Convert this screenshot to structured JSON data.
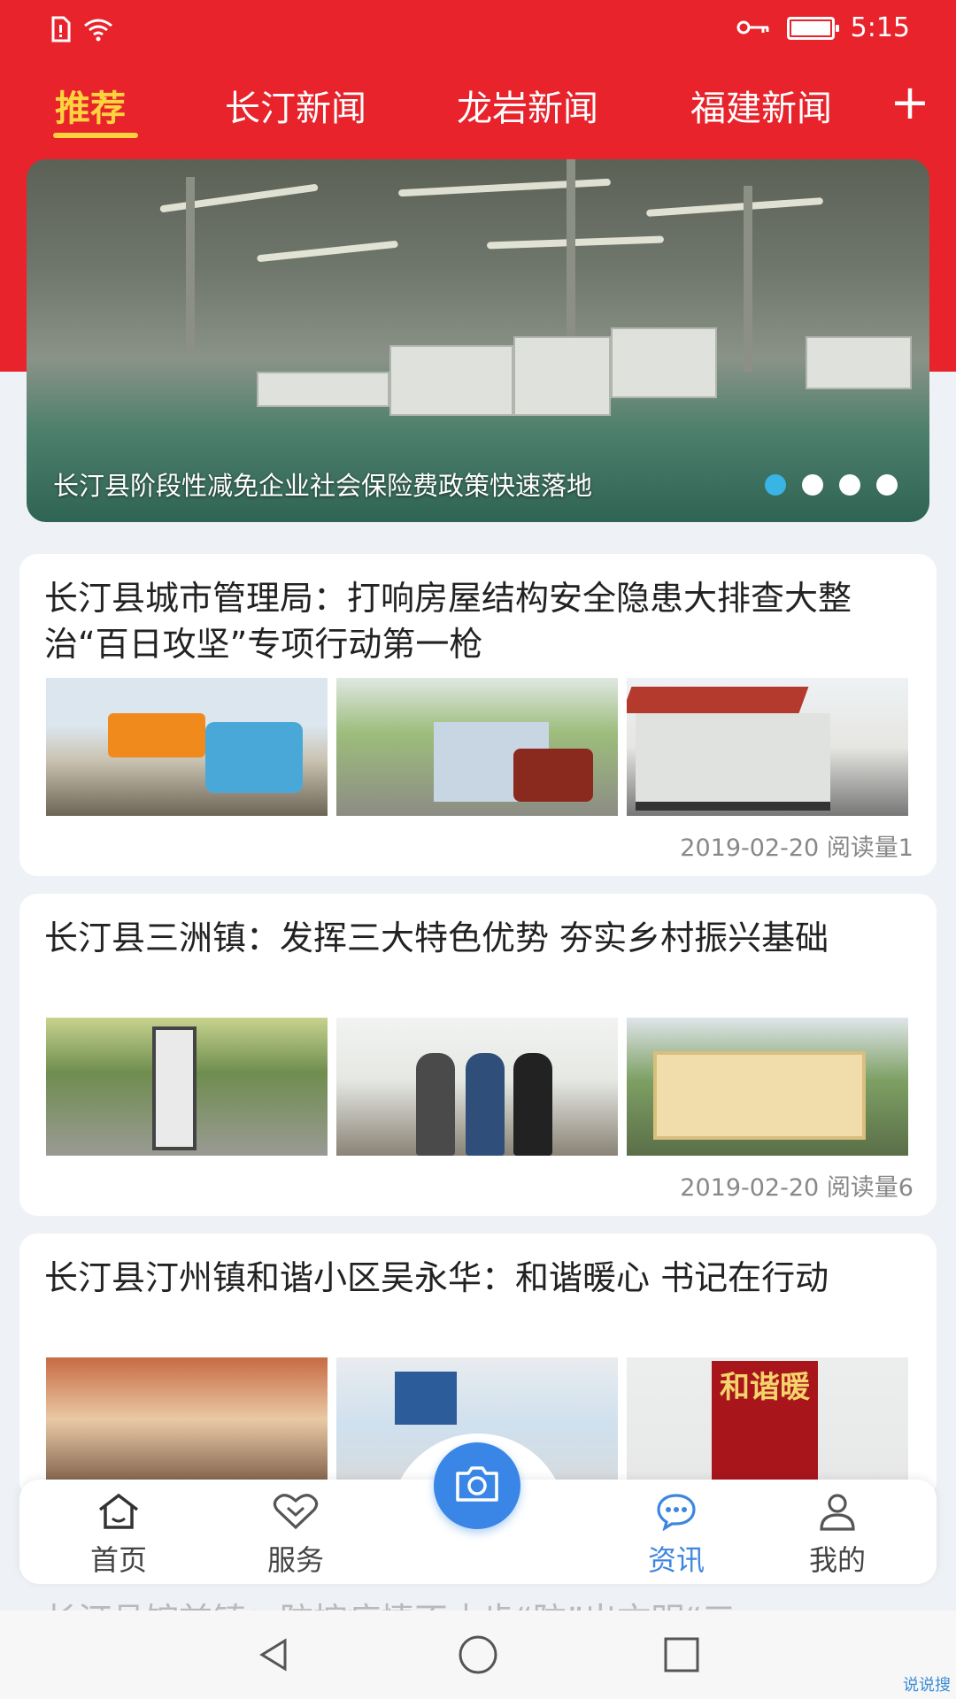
{
  "status_bar": {
    "time": "5:15"
  },
  "tabs": [
    {
      "label": "推荐",
      "active": true
    },
    {
      "label": "长汀新闻",
      "active": false
    },
    {
      "label": "龙岩新闻",
      "active": false
    },
    {
      "label": "福建新闻",
      "active": false
    }
  ],
  "add_tab_label": "+",
  "banner": {
    "caption": "长汀县阶段性减免企业社会保险费政策快速落地",
    "slides": 4,
    "active_slide": 1
  },
  "articles": [
    {
      "title": "长汀县城市管理局：打响房屋结构安全隐患大排查大整治“百日攻坚”专项行动第一枪",
      "date": "2019-02-20",
      "reads": "阅读量1"
    },
    {
      "title": "长汀县三洲镇：发挥三大特色优势 夯实乡村振兴基础",
      "date": "2019-02-20",
      "reads": "阅读量6"
    },
    {
      "title": "长汀县汀州镇和谐小区吴永华：和谐暖心 书记在行动"
    }
  ],
  "thumb_text": {
    "banner_chars": "和谐暖"
  },
  "peek_title": "长汀县馆前镇：防控疫情不止步“防”出文明“三",
  "bottom_nav": {
    "home": "首页",
    "service": "服务",
    "news": "资讯",
    "mine": "我的"
  },
  "colors": {
    "header_red": "#e8232b",
    "accent_blue": "#3d86e0",
    "tab_active": "#ffd23f"
  },
  "watermark": "说说搜"
}
